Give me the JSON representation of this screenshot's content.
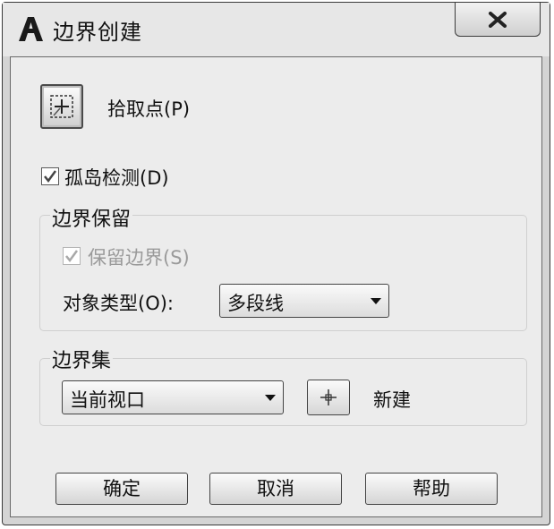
{
  "window": {
    "title": "边界创建"
  },
  "pick_points": {
    "label": "拾取点(P)"
  },
  "island_detection": {
    "label": "孤岛检测(D)",
    "checked": true
  },
  "boundary_retention": {
    "group_label": "边界保留",
    "retain_label": "保留边界(S)",
    "retain_checked": true,
    "retain_enabled": false,
    "object_type_label": "对象类型(O):",
    "object_type_value": "多段线"
  },
  "boundary_set": {
    "group_label": "边界集",
    "value": "当前视口",
    "new_label": "新建"
  },
  "buttons": {
    "ok": "确定",
    "cancel": "取消",
    "help": "帮助"
  }
}
